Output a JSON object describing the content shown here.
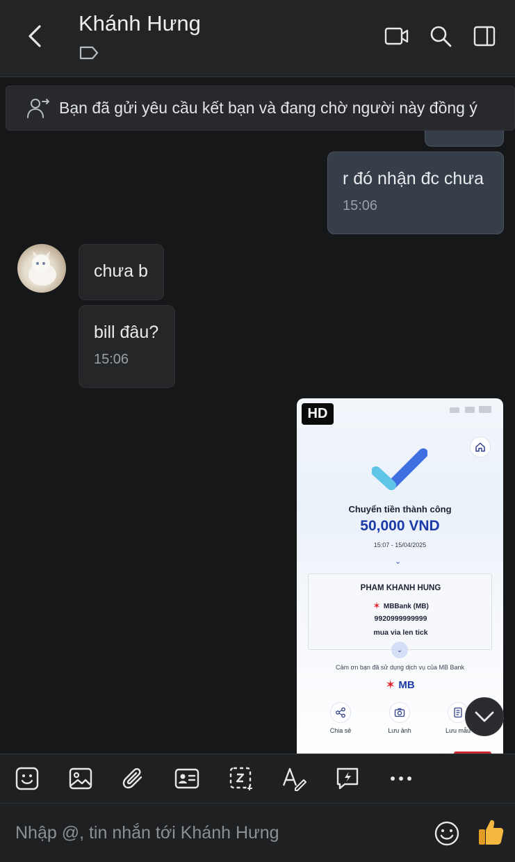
{
  "header": {
    "title": "Khánh Hưng"
  },
  "banner": {
    "text": "Bạn đã gửi yêu cầu kết bạn và đang chờ người này đồng ý"
  },
  "messages": [
    {
      "from": "me",
      "text": "r đó nhận đc chưa",
      "time": "15:06"
    },
    {
      "from": "them",
      "text": "chưa b"
    },
    {
      "from": "them",
      "text": "bill đâu?",
      "time": "15:06"
    }
  ],
  "image_message": {
    "badge": "HD",
    "receipt": {
      "status": "Chuyển tiền thành công",
      "amount": "50,000 VND",
      "datetime": "15:07 - 15/04/2025",
      "recipient_name": "PHAM KHANH HUNG",
      "bank": "MBBank (MB)",
      "account": "9920999999999",
      "note": "mua via len tick",
      "thanks": "Cảm ơn bạn đã sử dụng dịch vụ của MB Bank",
      "logo_text": "MB",
      "actions": [
        "Chia sẻ",
        "Lưu ảnh",
        "Lưu mẫu"
      ]
    }
  },
  "composer": {
    "placeholder": "Nhập @, tin nhắn tới Khánh Hưng"
  },
  "colors": {
    "background": "#161718",
    "header": "#222426",
    "my_bubble": "#363e4a",
    "their_bubble": "#242628",
    "accent_blue": "#1b3aa8",
    "like_yellow": "#f4b740"
  }
}
